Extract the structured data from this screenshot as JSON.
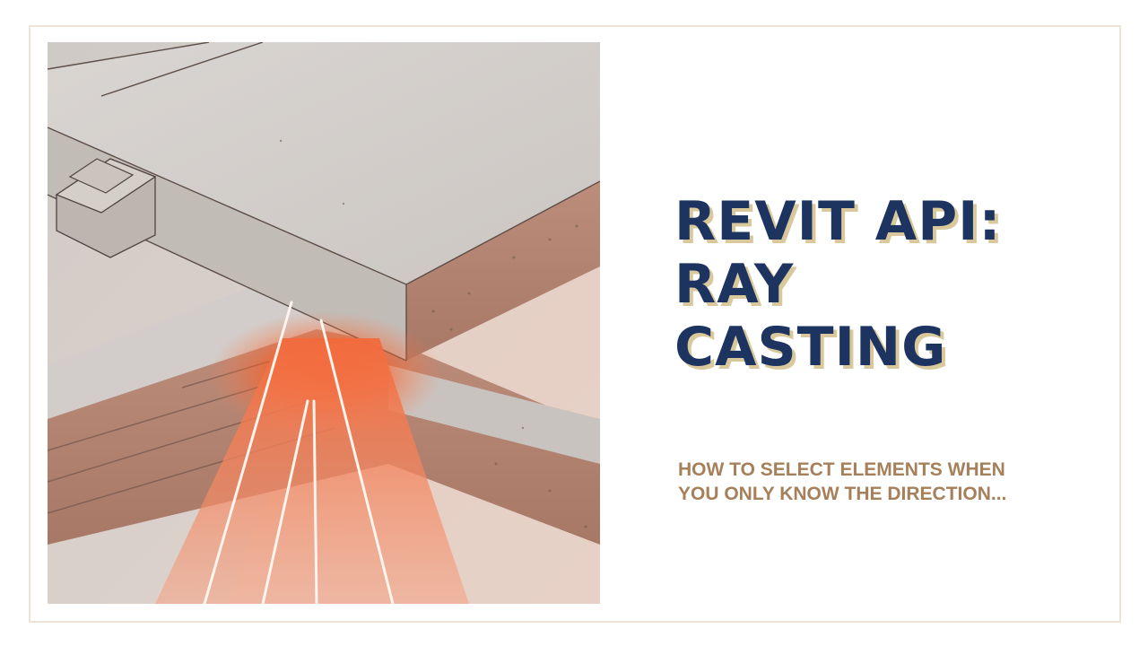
{
  "title": {
    "line1": "REVIT API:",
    "line2": "RAY",
    "line3": "CASTING"
  },
  "subtitle": {
    "line1": "HOW TO SELECT ELEMENTS WHEN",
    "line2": "YOU ONLY KNOW THE DIRECTION..."
  },
  "illustration": {
    "icon": "ray-casting-illustration",
    "colors": {
      "concrete": "#d6d2ce",
      "slab_side": "#b48474",
      "ray_glow": "#ff5a1e"
    }
  },
  "colors": {
    "title": "#1d3461",
    "title_shadow": "#d8c89b",
    "subtitle": "#a5805a",
    "frame_border": "#ece4d8"
  }
}
